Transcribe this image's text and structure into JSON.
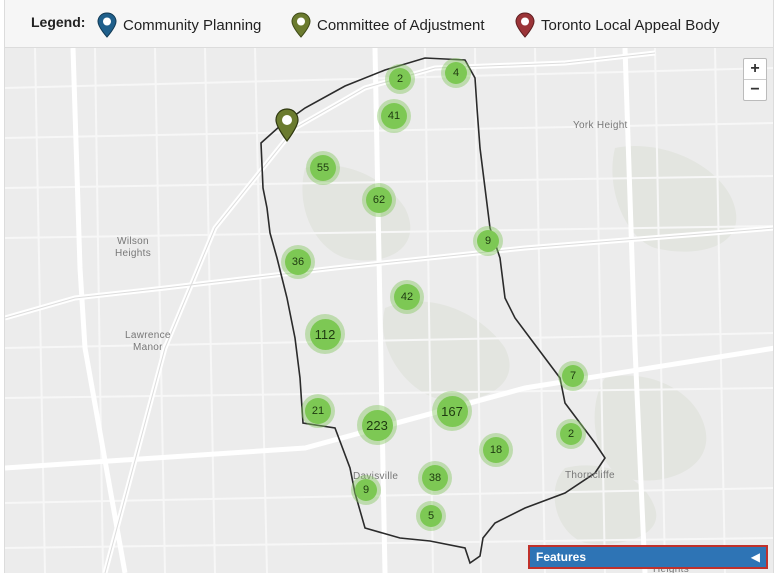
{
  "legend": {
    "title": "Legend:",
    "items": [
      {
        "label": "Community Planning",
        "color": "#1f5f8b",
        "icon": "map-pin-icon"
      },
      {
        "label": "Committee of Adjustment",
        "color": "#6b7b2f",
        "icon": "map-pin-icon"
      },
      {
        "label": "Toronto Local Appeal Body",
        "color": "#9b3438",
        "icon": "map-pin-icon"
      }
    ]
  },
  "map": {
    "places": [
      {
        "name": "York Height"
      },
      {
        "name": "Wilson\nHeights"
      },
      {
        "name": "Lawrence\nManor"
      },
      {
        "name": "Davisville"
      },
      {
        "name": "Thorncliffe"
      },
      {
        "name": "Heights"
      }
    ],
    "clusters": [
      {
        "count": "2"
      },
      {
        "count": "4"
      },
      {
        "count": "41"
      },
      {
        "count": "55"
      },
      {
        "count": "62"
      },
      {
        "count": "9"
      },
      {
        "count": "36"
      },
      {
        "count": "42"
      },
      {
        "count": "112"
      },
      {
        "count": "7"
      },
      {
        "count": "21"
      },
      {
        "count": "223"
      },
      {
        "count": "167"
      },
      {
        "count": "2"
      },
      {
        "count": "18"
      },
      {
        "count": "38"
      },
      {
        "count": "9"
      },
      {
        "count": "5"
      }
    ],
    "marker_color": "#6b7b2f",
    "cluster_color": "#7dc854"
  },
  "zoom": {
    "in": "+",
    "out": "−"
  },
  "features": {
    "label": "Features",
    "toggle": "◀"
  }
}
